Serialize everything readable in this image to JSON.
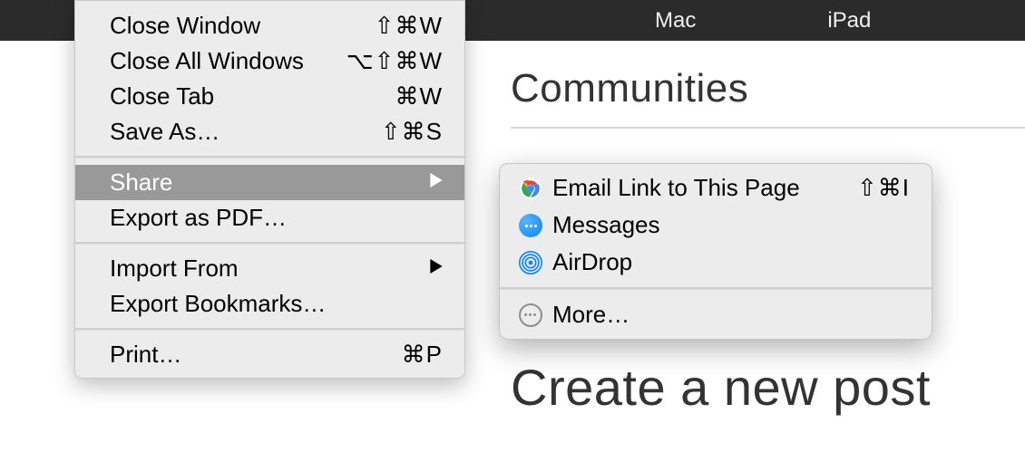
{
  "topnav": {
    "items": [
      "Mac",
      "iPad"
    ]
  },
  "page": {
    "section_title": "Communities",
    "heading": "Create a new post"
  },
  "menu": {
    "items": [
      {
        "label": "Close Window",
        "shortcut": "⇧⌘W"
      },
      {
        "label": "Close All Windows",
        "shortcut": "⌥⇧⌘W"
      },
      {
        "label": "Close Tab",
        "shortcut": "⌘W"
      },
      {
        "label": "Save As…",
        "shortcut": "⇧⌘S"
      }
    ],
    "share": {
      "label": "Share"
    },
    "export_pdf": {
      "label": "Export as PDF…"
    },
    "import_from": {
      "label": "Import From"
    },
    "export_bookmarks": {
      "label": "Export Bookmarks…"
    },
    "print": {
      "label": "Print…",
      "shortcut": "⌘P"
    }
  },
  "submenu": {
    "email": {
      "label": "Email Link to This Page",
      "shortcut": "⇧⌘I"
    },
    "messages": {
      "label": "Messages"
    },
    "airdrop": {
      "label": "AirDrop"
    },
    "more": {
      "label": "More…"
    }
  }
}
